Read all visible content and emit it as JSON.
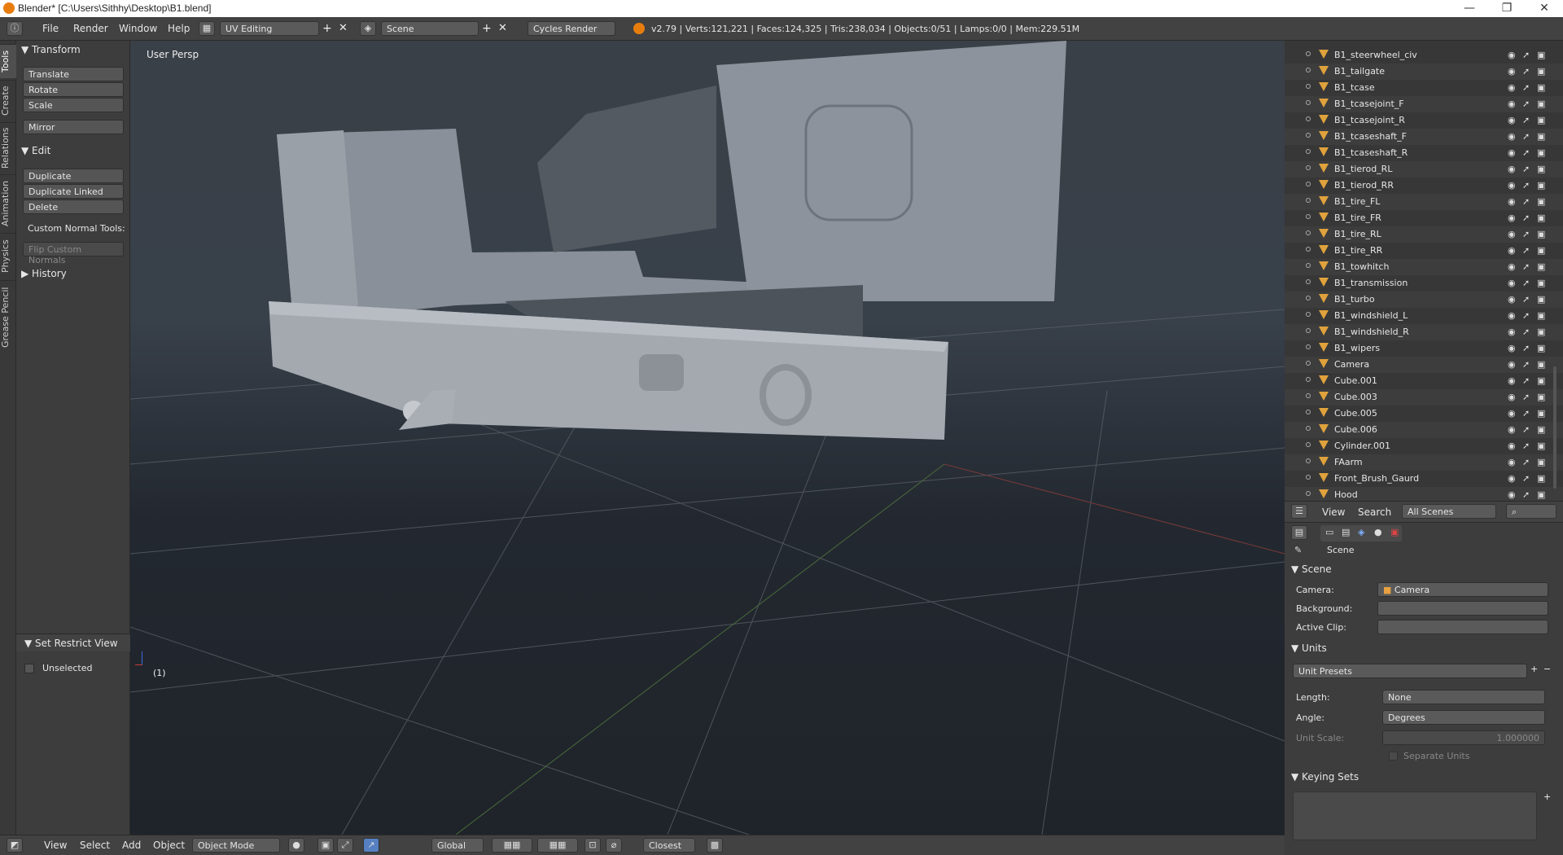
{
  "window": {
    "title": "Blender* [C:\\Users\\Sithhy\\Desktop\\B1.blend]",
    "controls": [
      "—",
      "❐",
      "✕"
    ]
  },
  "info_header": {
    "menus": [
      "File",
      "Render",
      "Window",
      "Help"
    ],
    "screen_layout": "UV Editing",
    "scene": "Scene",
    "render_engine": "Cycles Render",
    "stats": "v2.79 | Verts:121,221 | Faces:124,325 | Tris:238,034 | Objects:0/51 | Lamps:0/0 | Mem:229.51M"
  },
  "tool_tabs": [
    "Tools",
    "Create",
    "Relations",
    "Animation",
    "Physics",
    "Grease Pencil"
  ],
  "tool_shelf": {
    "transform": {
      "header": "Transform",
      "buttons": [
        "Translate",
        "Rotate",
        "Scale",
        "Mirror"
      ]
    },
    "edit": {
      "header": "Edit",
      "buttons": [
        "Duplicate",
        "Duplicate Linked",
        "Delete"
      ]
    },
    "custom_normal_label": "Custom Normal Tools:",
    "flip_custom_normals": "Flip Custom Normals",
    "history": "History",
    "restrict": {
      "header": "Set Restrict View",
      "checkbox_label": "Unselected"
    }
  },
  "viewport": {
    "label": "User Persp",
    "frame_counter": "(1)"
  },
  "viewport_header": {
    "menus": [
      "View",
      "Select",
      "Add",
      "Object"
    ],
    "mode": "Object Mode",
    "orientation": "Global",
    "snap": "Closest"
  },
  "outliner": {
    "items": [
      {
        "name": "B1_steerwheel_civ"
      },
      {
        "name": "B1_tailgate"
      },
      {
        "name": "B1_tcase"
      },
      {
        "name": "B1_tcasejoint_F"
      },
      {
        "name": "B1_tcasejoint_R"
      },
      {
        "name": "B1_tcaseshaft_F"
      },
      {
        "name": "B1_tcaseshaft_R"
      },
      {
        "name": "B1_tierod_RL"
      },
      {
        "name": "B1_tierod_RR"
      },
      {
        "name": "B1_tire_FL"
      },
      {
        "name": "B1_tire_FR"
      },
      {
        "name": "B1_tire_RL"
      },
      {
        "name": "B1_tire_RR"
      },
      {
        "name": "B1_towhitch"
      },
      {
        "name": "B1_transmission"
      },
      {
        "name": "B1_turbo"
      },
      {
        "name": "B1_windshield_L"
      },
      {
        "name": "B1_windshield_R"
      },
      {
        "name": "B1_wipers"
      },
      {
        "name": "Camera"
      },
      {
        "name": "Cube.001"
      },
      {
        "name": "Cube.003"
      },
      {
        "name": "Cube.005"
      },
      {
        "name": "Cube.006"
      },
      {
        "name": "Cylinder.001"
      },
      {
        "name": "FAarm"
      },
      {
        "name": "Front_Brush_Gaurd"
      },
      {
        "name": "Hood"
      }
    ],
    "header": {
      "menus": [
        "View",
        "Search"
      ],
      "filter": "All Scenes"
    }
  },
  "properties": {
    "context": "Scene",
    "scene_panel": {
      "header": "Scene",
      "camera_label": "Camera:",
      "camera_value": "Camera",
      "background_label": "Background:",
      "active_clip_label": "Active Clip:"
    },
    "units_panel": {
      "header": "Units",
      "presets": "Unit Presets",
      "length_label": "Length:",
      "length_value": "None",
      "angle_label": "Angle:",
      "angle_value": "Degrees",
      "unit_scale_label": "Unit Scale:",
      "unit_scale_value": "1.000000",
      "separate_units": "Separate Units"
    },
    "keying_sets": {
      "header": "Keying Sets"
    }
  }
}
